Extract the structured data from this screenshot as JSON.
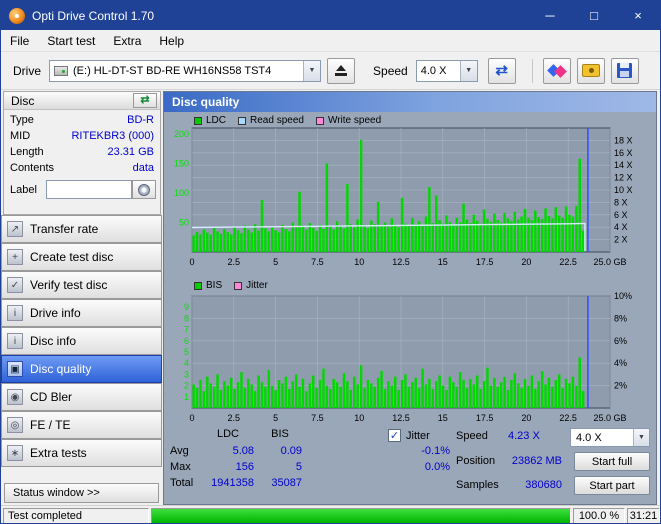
{
  "window": {
    "title": "Opti Drive Control 1.70",
    "controls": {
      "minimize": "─",
      "maximize": "□",
      "close": "×"
    }
  },
  "menu": {
    "items": [
      "File",
      "Start test",
      "Extra",
      "Help"
    ]
  },
  "toolbar": {
    "drive_label": "Drive",
    "drive_value": "(E:)  HL-DT-ST BD-RE  WH16NS58 TST4",
    "speed_label": "Speed",
    "speed_value": "4.0 X"
  },
  "sidebar": {
    "group_title": "Disc",
    "info": [
      {
        "label": "Type",
        "value": "BD-R"
      },
      {
        "label": "MID",
        "value": "RITEKBR3 (000)"
      },
      {
        "label": "Length",
        "value": "23.31 GB"
      },
      {
        "label": "Contents",
        "value": "data"
      }
    ],
    "label_field": {
      "label": "Label",
      "value": ""
    },
    "buttons": [
      {
        "label": "Transfer rate",
        "icon_glyph": "↗",
        "active": false
      },
      {
        "label": "Create test disc",
        "icon_glyph": "+",
        "active": false
      },
      {
        "label": "Verify test disc",
        "icon_glyph": "✓",
        "active": false
      },
      {
        "label": "Drive info",
        "icon_glyph": "i",
        "active": false
      },
      {
        "label": "Disc info",
        "icon_glyph": "i",
        "active": false
      },
      {
        "label": "Disc quality",
        "icon_glyph": "▣",
        "active": true
      },
      {
        "label": "CD Bler",
        "icon_glyph": "◉",
        "active": false
      },
      {
        "label": "FE / TE",
        "icon_glyph": "◎",
        "active": false
      },
      {
        "label": "Extra tests",
        "icon_glyph": "∗",
        "active": false
      }
    ],
    "status_window_label": "Status window >>"
  },
  "panel": {
    "title": "Disc quality"
  },
  "chart_data": [
    {
      "type": "bar+line",
      "title": "Disc quality",
      "legend": [
        {
          "label": "LDC",
          "color": "#00cc00"
        },
        {
          "label": "Read speed",
          "color": "#a8d8ff"
        },
        {
          "label": "Write speed",
          "color": "#ff86d8"
        }
      ],
      "x_ticks": [
        "0",
        "2.5",
        "5",
        "7.5",
        "10",
        "12.5",
        "15",
        "17.5",
        "20",
        "22.5",
        "25.0 GB"
      ],
      "left_ticks": [
        50,
        100,
        150,
        200
      ],
      "left_max": 210,
      "right_ticks": [
        {
          "value": 2,
          "label": "2 X"
        },
        {
          "value": 4,
          "label": "4 X"
        },
        {
          "value": 6,
          "label": "6 X"
        },
        {
          "value": 8,
          "label": "8 X"
        },
        {
          "value": 10,
          "label": "10 X"
        },
        {
          "value": 12,
          "label": "12 X"
        },
        {
          "value": 14,
          "label": "14 X"
        },
        {
          "value": 16,
          "label": "16 X"
        },
        {
          "value": 18,
          "label": "18 X"
        }
      ],
      "right_max": 20,
      "end_frac": 0.94,
      "bars": [
        28,
        34,
        30,
        38,
        33,
        29,
        41,
        35,
        31,
        39,
        34,
        30,
        43,
        37,
        32,
        45,
        38,
        33,
        47,
        36,
        88,
        40,
        35,
        42,
        37,
        33,
        46,
        39,
        35,
        50,
        42,
        102,
        45,
        38,
        49,
        41,
        36,
        46,
        39,
        150,
        44,
        38,
        52,
        45,
        40,
        115,
        47,
        42,
        55,
        190,
        46,
        41,
        53,
        47,
        85,
        44,
        50,
        43,
        57,
        46,
        42,
        92,
        48,
        44,
        58,
        47,
        52,
        45,
        60,
        110,
        49,
        96,
        54,
        48,
        62,
        51,
        46,
        58,
        50,
        82,
        55,
        49,
        63,
        53,
        48,
        72,
        56,
        51,
        65,
        54,
        50,
        66,
        57,
        52,
        68,
        55,
        60,
        73,
        58,
        54,
        70,
        59,
        56,
        74,
        61,
        57,
        76,
        62,
        58,
        77,
        63,
        60,
        78,
        158,
        36
      ],
      "line_points": [
        [
          0,
          3.95
        ],
        [
          0.1,
          4.02
        ],
        [
          0.2,
          4.08
        ],
        [
          0.3,
          4.15
        ],
        [
          0.4,
          4.22
        ],
        [
          0.5,
          4.28
        ],
        [
          0.6,
          4.35
        ],
        [
          0.7,
          4.42
        ],
        [
          0.8,
          4.48
        ],
        [
          0.9,
          4.55
        ],
        [
          0.94,
          4.6
        ]
      ],
      "colors": {
        "plot_bg": "#8f9cad",
        "grid": "#a9b4c2",
        "border": "#3f4a58",
        "bar": "#00d800",
        "tick_left": "#00e400",
        "line": "#d4ecff",
        "marker": "#2d50ff"
      }
    },
    {
      "type": "bar",
      "legend": [
        {
          "label": "BIS",
          "color": "#00cc00"
        },
        {
          "label": "Jitter",
          "color": "#ff86d8"
        }
      ],
      "x_ticks": [
        "0",
        "2.5",
        "5",
        "7.5",
        "10",
        "12.5",
        "15",
        "17.5",
        "20",
        "22.5",
        "25.0 GB"
      ],
      "left_ticks": [
        1,
        2,
        3,
        4,
        5,
        6,
        7,
        8,
        9
      ],
      "left_max": 10,
      "right_ticks": [
        {
          "value": 2,
          "label": "2%"
        },
        {
          "value": 4,
          "label": "4%"
        },
        {
          "value": 6,
          "label": "6%"
        },
        {
          "value": 8,
          "label": "8%"
        },
        {
          "value": 10,
          "label": "10%"
        }
      ],
      "right_max": 10,
      "end_frac": 0.94,
      "bars": [
        2.1,
        1.8,
        2.5,
        1.5,
        2.8,
        2.2,
        1.9,
        3.0,
        1.6,
        2.4,
        2.0,
        2.7,
        1.7,
        2.3,
        3.2,
        1.8,
        2.6,
        2.1,
        1.5,
        2.9,
        2.3,
        1.9,
        3.4,
        2.0,
        1.6,
        2.5,
        2.2,
        2.8,
        1.7,
        2.4,
        3.0,
        1.9,
        2.6,
        1.5,
        2.2,
        2.9,
        1.8,
        2.5,
        3.5,
        2.0,
        1.7,
        2.6,
        2.3,
        1.9,
        3.1,
        2.4,
        1.6,
        2.8,
        2.1,
        3.8,
        1.8,
        2.5,
        2.2,
        1.9,
        2.7,
        3.3,
        1.7,
        2.4,
        2.0,
        2.8,
        1.6,
        2.5,
        3.0,
        1.9,
        2.3,
        2.7,
        1.8,
        3.5,
        2.1,
        2.6,
        1.7,
        2.4,
        2.9,
        2.0,
        1.6,
        2.8,
        2.3,
        1.9,
        3.2,
        2.5,
        1.8,
        2.6,
        2.1,
        2.9,
        1.7,
        2.4,
        3.6,
        2.0,
        2.7,
        1.9,
        2.3,
        2.8,
        1.6,
        2.5,
        3.1,
        2.2,
        1.8,
        2.6,
        2.0,
        2.9,
        1.7,
        2.4,
        3.3,
        2.1,
        2.7,
        1.9,
        2.5,
        3.0,
        1.8,
        2.6,
        2.2,
        2.8,
        2.0,
        4.5,
        1.5
      ],
      "line_points": null,
      "colors": {
        "plot_bg": "#8f9cad",
        "grid": "#a9b4c2",
        "border": "#3f4a58",
        "bar": "#00d800",
        "tick_left": "#00e400",
        "marker": "#2d50ff"
      }
    }
  ],
  "stats": {
    "col_ldc": "LDC",
    "col_bis": "BIS",
    "jitter_label": "Jitter",
    "row_avg": {
      "label": "Avg",
      "ldc": "5.08",
      "bis": "0.09",
      "jitter": "-0.1%"
    },
    "row_max": {
      "label": "Max",
      "ldc": "156",
      "bis": "5",
      "jitter": "0.0%"
    },
    "row_total": {
      "label": "Total",
      "ldc": "1941358",
      "bis": "35087",
      "jitter": ""
    },
    "speed_label": "Speed",
    "speed_value": "4.23 X",
    "speed_select": "4.0 X",
    "position_label": "Position",
    "position_value": "23862 MB",
    "samples_label": "Samples",
    "samples_value": "380680",
    "start_full_label": "Start full",
    "start_part_label": "Start part"
  },
  "statusbar": {
    "status": "Test completed",
    "progress_pct": 100,
    "progress_text": "100.0 %",
    "time": "31:21"
  }
}
